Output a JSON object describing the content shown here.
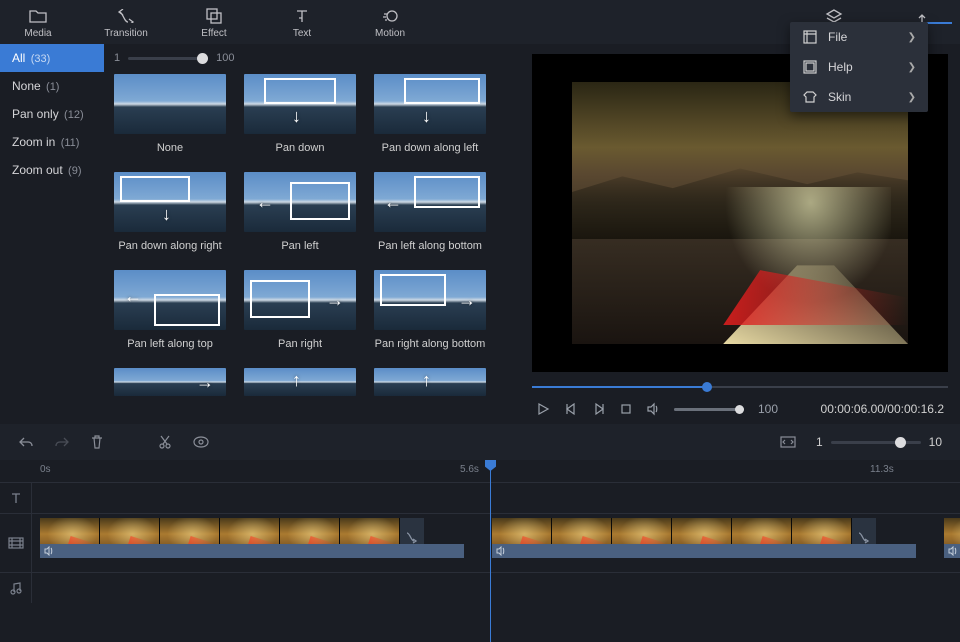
{
  "toolbar": {
    "items": [
      {
        "label": "Media",
        "icon": "folder"
      },
      {
        "label": "Transition",
        "icon": "transition"
      },
      {
        "label": "Effect",
        "icon": "effect"
      },
      {
        "label": "Text",
        "icon": "text"
      },
      {
        "label": "Motion",
        "icon": "motion"
      }
    ],
    "right": [
      {
        "label": "Template",
        "icon": "template"
      },
      {
        "label": "",
        "icon": "export"
      }
    ]
  },
  "context_menu": {
    "items": [
      {
        "label": "File",
        "icon": "file"
      },
      {
        "label": "Help",
        "icon": "help"
      },
      {
        "label": "Skin",
        "icon": "skin"
      }
    ]
  },
  "sidebar": {
    "items": [
      {
        "label": "All",
        "count": "(33)",
        "active": true
      },
      {
        "label": "None",
        "count": "(1)"
      },
      {
        "label": "Pan only",
        "count": "(12)"
      },
      {
        "label": "Zoom in",
        "count": "(11)"
      },
      {
        "label": "Zoom out",
        "count": "(9)"
      }
    ]
  },
  "gallery": {
    "size_min": "1",
    "size_max": "100",
    "rows": [
      [
        {
          "label": "None",
          "overlay": "none"
        },
        {
          "label": "Pan down",
          "overlay": "pandown"
        },
        {
          "label": "Pan down along left",
          "overlay": "pandownleft"
        }
      ],
      [
        {
          "label": "Pan down along right",
          "overlay": "pandownright"
        },
        {
          "label": "Pan left",
          "overlay": "panleft"
        },
        {
          "label": "Pan left along bottom",
          "overlay": "panleftbottom"
        }
      ],
      [
        {
          "label": "Pan left along top",
          "overlay": "panlefttop"
        },
        {
          "label": "Pan right",
          "overlay": "panright"
        },
        {
          "label": "Pan right along bottom",
          "overlay": "panrightbottom"
        }
      ],
      [
        {
          "label": "",
          "overlay": "partial1"
        },
        {
          "label": "",
          "overlay": "partial2"
        },
        {
          "label": "",
          "overlay": "partial3"
        }
      ]
    ]
  },
  "preview": {
    "volume": "100",
    "timecode": "00:00:06.00/00:00:16.2"
  },
  "editor": {
    "zoom_min": "1",
    "zoom_max": "10"
  },
  "timeline": {
    "ruler": [
      "0s",
      "5.6s",
      "11.3s"
    ],
    "ruler_pos": [
      "40",
      "490",
      "870"
    ]
  }
}
